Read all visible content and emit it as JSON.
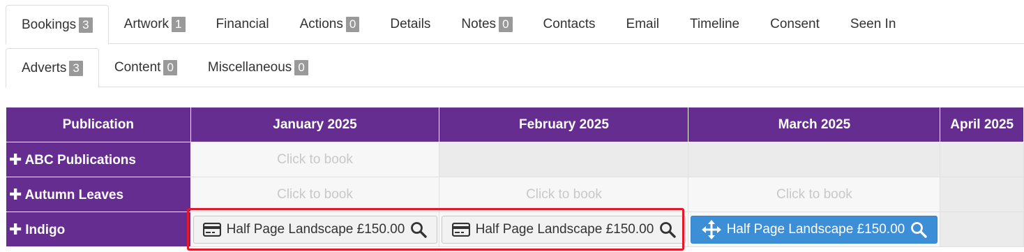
{
  "tabs_primary": [
    {
      "label": "Bookings",
      "badge": "3",
      "active": true
    },
    {
      "label": "Artwork",
      "badge": "1"
    },
    {
      "label": "Financial"
    },
    {
      "label": "Actions",
      "badge": "0"
    },
    {
      "label": "Details"
    },
    {
      "label": "Notes",
      "badge": "0"
    },
    {
      "label": "Contacts"
    },
    {
      "label": "Email"
    },
    {
      "label": "Timeline"
    },
    {
      "label": "Consent"
    },
    {
      "label": "Seen In"
    }
  ],
  "tabs_secondary": [
    {
      "label": "Adverts",
      "badge": "3",
      "active": true
    },
    {
      "label": "Content",
      "badge": "0"
    },
    {
      "label": "Miscellaneous",
      "badge": "0"
    }
  ],
  "grid": {
    "header": [
      "Publication",
      "January 2025",
      "February 2025",
      "March 2025",
      "April 2025"
    ],
    "click_to_book": "Click to book",
    "rows": [
      {
        "publication": "ABC Publications"
      },
      {
        "publication": "Autumn Leaves"
      },
      {
        "publication": "Indigo"
      }
    ],
    "bookings": [
      {
        "label": "Half Page Landscape £150.00",
        "icon": "credit-card-icon",
        "style": "grey"
      },
      {
        "label": "Half Page Landscape £150.00",
        "icon": "credit-card-icon",
        "style": "grey"
      },
      {
        "label": "Half Page Landscape £150.00",
        "icon": "move-arrows-icon",
        "style": "blue"
      }
    ]
  },
  "colors": {
    "header_purple": "#652d90",
    "booking_blue": "#3c8fd6",
    "highlight_red": "#e3182a",
    "badge_grey": "#999999"
  }
}
